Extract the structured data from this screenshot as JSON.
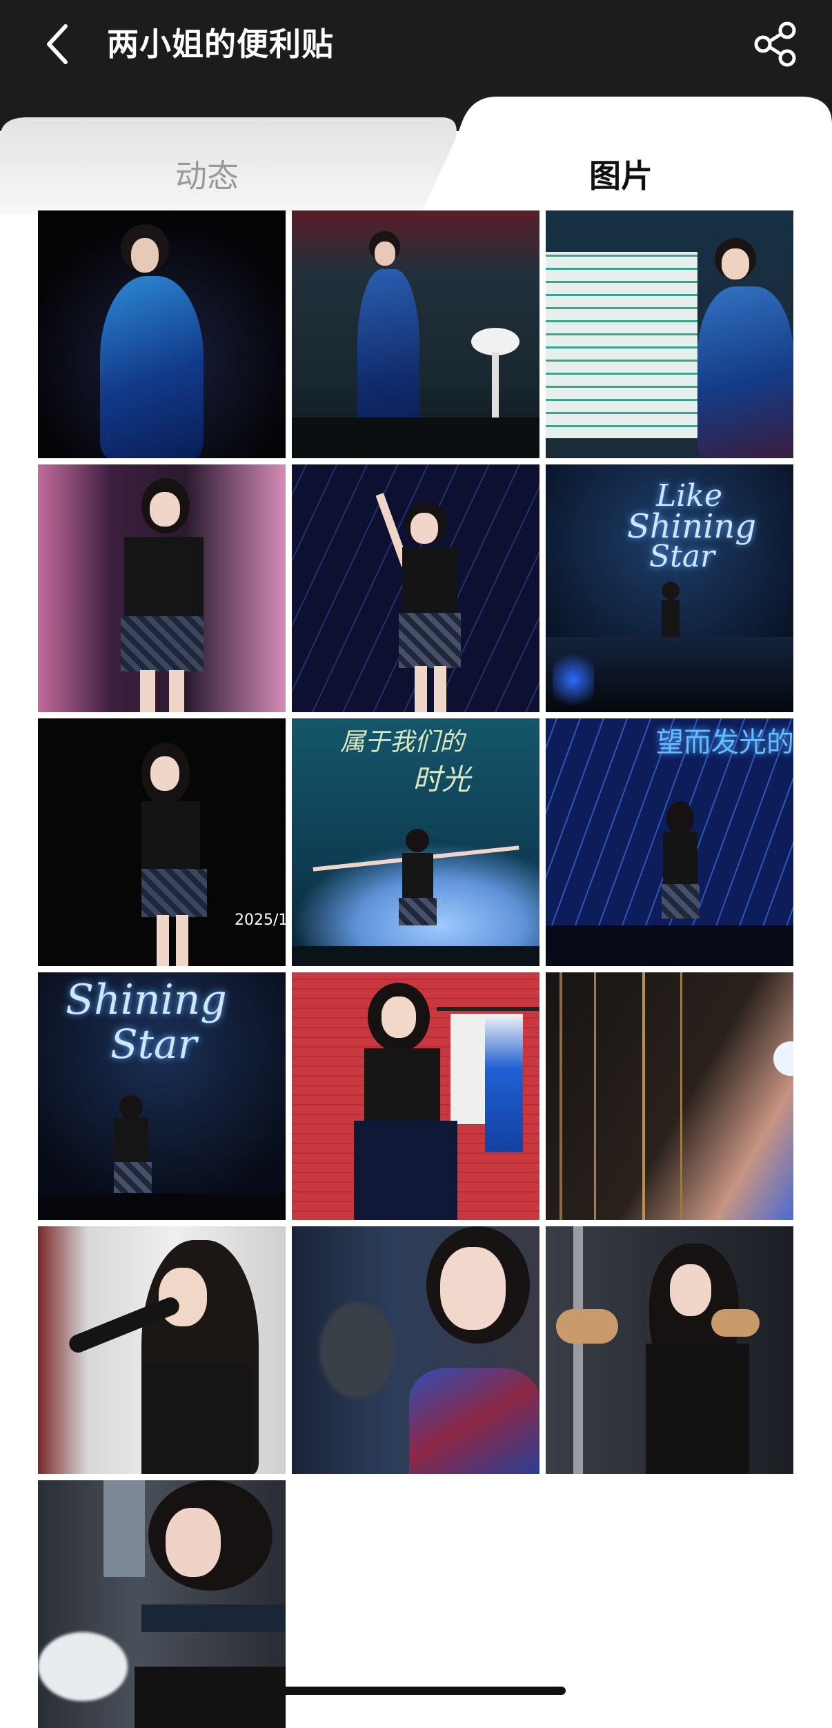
{
  "header": {
    "title": "两小姐的便利贴",
    "back_icon": "chevron-left-icon",
    "share_icon": "share-icon"
  },
  "tabs": [
    {
      "label": "动态",
      "active": false
    },
    {
      "label": "图片",
      "active": true
    }
  ],
  "gallery": {
    "photos": [
      {
        "id": 1,
        "scene": "performer in blue gown singing, dark stage"
      },
      {
        "id": 2,
        "scene": "performer in blue gown on stage with cloud props"
      },
      {
        "id": 3,
        "scene": "performer beside board of sticky notes"
      },
      {
        "id": 4,
        "scene": "performer singing in front of pink screen"
      },
      {
        "id": 5,
        "scene": "performer waving under blue light rain"
      },
      {
        "id": 6,
        "scene": "stage with glowing Like Shining Star sign",
        "overlay_text_lines": [
          "Like",
          "Shining",
          "Star"
        ]
      },
      {
        "id": 7,
        "scene": "performer singing, dark stage, date text",
        "overlay_text": "2025/1"
      },
      {
        "id": 8,
        "scene": "performer with arms outstretched, handwritten screen text",
        "overlay_text_lines": [
          "属于我们的",
          "时光"
        ]
      },
      {
        "id": 9,
        "scene": "performer on stage under blue streaks, screen text",
        "overlay_text": "望而发光的"
      },
      {
        "id": 10,
        "scene": "Shining Star sign above stage performer",
        "overlay_text_lines": [
          "Shining",
          "Star"
        ]
      },
      {
        "id": 11,
        "scene": "performer in black top beside clothing rack on red background"
      },
      {
        "id": 12,
        "scene": "close-up of dark hair with gold strands"
      },
      {
        "id": 13,
        "scene": "performer holding microphone backstage"
      },
      {
        "id": 14,
        "scene": "close-up portrait in blue gown with makeup artist"
      },
      {
        "id": 15,
        "scene": "performer seated backstage in black outfit"
      },
      {
        "id": 16,
        "scene": "backstage portrait with makeup being applied"
      }
    ]
  },
  "colors": {
    "header_bg": "#1c1c1c",
    "active_tab_text": "#111111",
    "inactive_tab_text": "#9a9a9a",
    "page_bg": "#ffffff"
  }
}
